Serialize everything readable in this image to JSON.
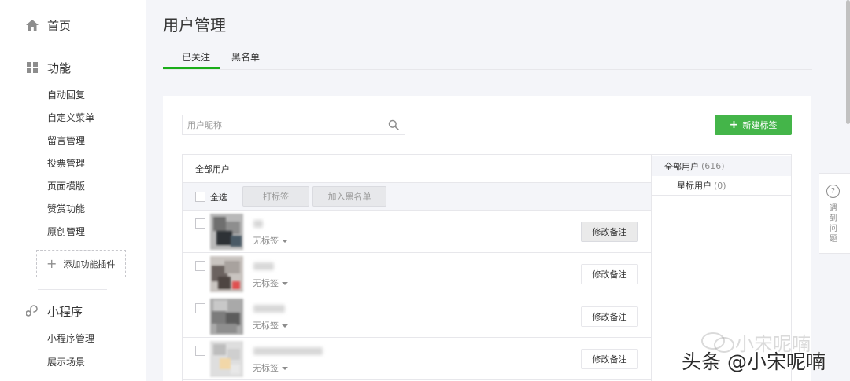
{
  "sidebar": {
    "home": "首页",
    "features": "功能",
    "feature_items": [
      "自动回复",
      "自定义菜单",
      "留言管理",
      "投票管理",
      "页面模版",
      "赞赏功能",
      "原创管理"
    ],
    "add_plugin": "添加功能插件",
    "miniprogram": "小程序",
    "miniprogram_items": [
      "小程序管理",
      "展示场景"
    ]
  },
  "page": {
    "title": "用户管理",
    "tabs": [
      "已关注",
      "黑名单"
    ],
    "active_tab": "已关注"
  },
  "search": {
    "placeholder": "用户昵称"
  },
  "toolbar": {
    "new_tag": "新建标签",
    "table_title": "全部用户",
    "select_all": "全选",
    "tag_button": "打标签",
    "blacklist_button": "加入黑名单"
  },
  "rows": [
    {
      "tag": "无标签",
      "remark": "修改备注",
      "hovered": true
    },
    {
      "tag": "无标签",
      "remark": "修改备注",
      "hovered": false
    },
    {
      "tag": "无标签",
      "remark": "修改备注",
      "hovered": false
    },
    {
      "tag": "无标签",
      "remark": "修改备注",
      "hovered": false
    }
  ],
  "groups": {
    "all": {
      "label": "全部用户",
      "count": "(616)"
    },
    "starred": {
      "label": "星标用户",
      "count": "(0)"
    }
  },
  "help": {
    "icon": "?",
    "label": "遇到问题"
  },
  "watermark": {
    "faint": "小宋呢喃",
    "main": "头条 @小宋呢喃"
  },
  "colors": {
    "accent_green": "#44b549",
    "tab_underline": "#1aad19"
  }
}
